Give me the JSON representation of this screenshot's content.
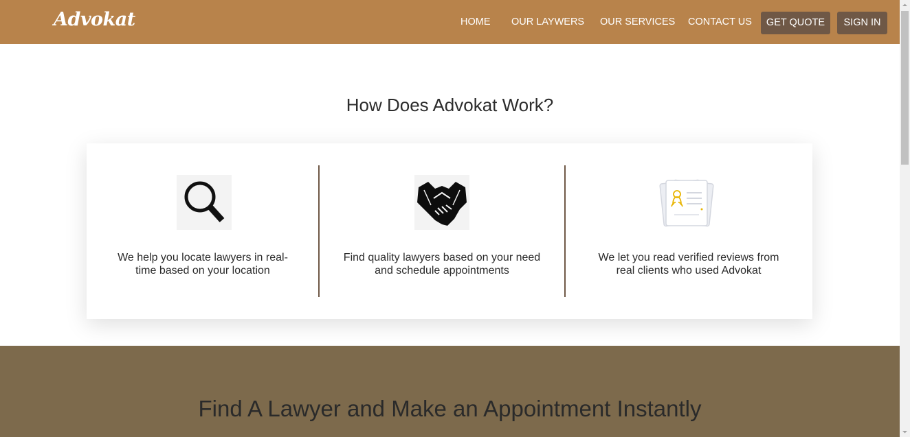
{
  "brand": {
    "logo": "Advokat",
    "primary_color": "#b8834b",
    "button_color": "#6f5846",
    "section_color": "#7d6a4c"
  },
  "nav": {
    "links": [
      "HOME",
      "OUR LAYWERS",
      "OUR SERVICES",
      "CONTACT US"
    ],
    "get_quote": "GET QUOTE",
    "sign_in": "SIGN IN"
  },
  "how": {
    "title": "How Does Advokat Work?",
    "features": [
      {
        "icon": "magnifier-icon",
        "text": "We help you locate lawyers in real-time based on your location"
      },
      {
        "icon": "handshake-icon",
        "text": "Find quality lawyers based on your need and schedule appointments"
      },
      {
        "icon": "review-document-icon",
        "text": "We let you read verified reviews from real clients who used Advokat"
      }
    ]
  },
  "find": {
    "title": "Find A Lawyer and Make an Appointment Instantly"
  }
}
